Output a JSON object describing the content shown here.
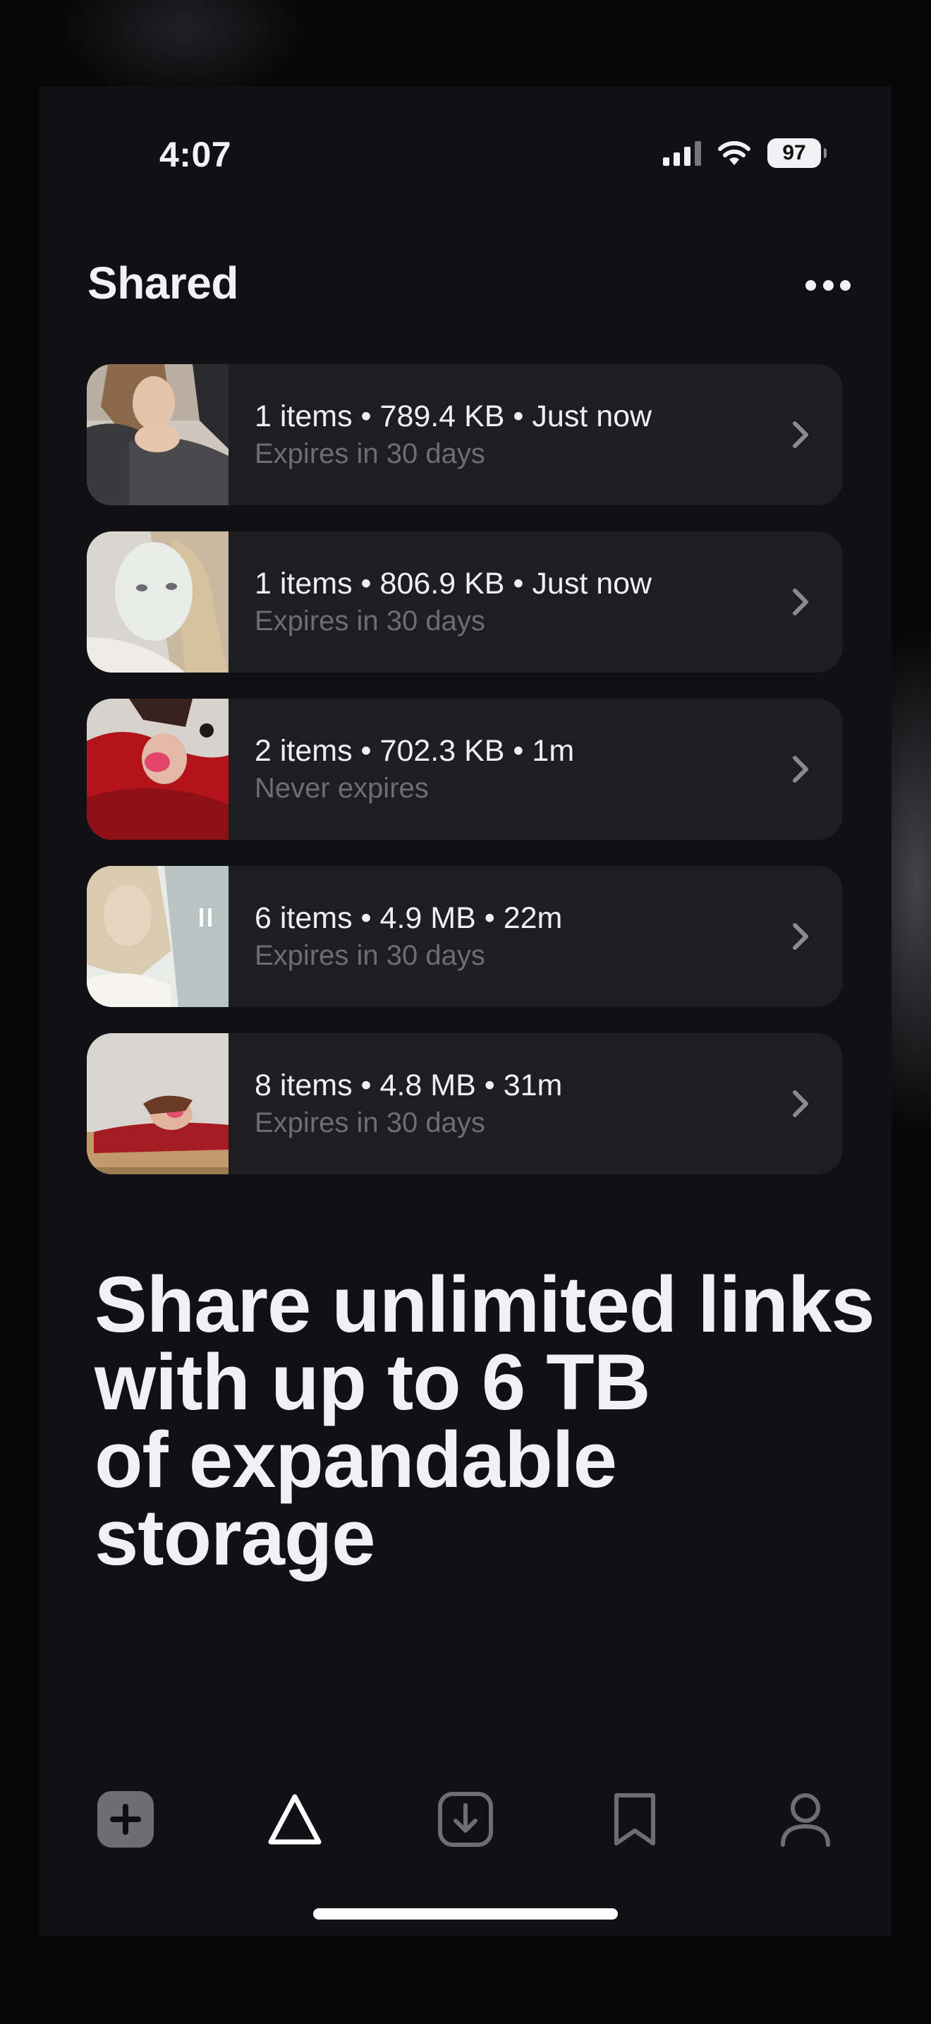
{
  "status_bar": {
    "time": "4:07",
    "battery": "97"
  },
  "header": {
    "title": "Shared",
    "more_icon": "ellipsis-icon"
  },
  "shared_items": [
    {
      "meta": "1 items • 789.4 KB • Just now",
      "expiry": "Expires in 30 days"
    },
    {
      "meta": "1 items • 806.9 KB • Just now",
      "expiry": "Expires in 30 days"
    },
    {
      "meta": "2 items • 702.3 KB • 1m",
      "expiry": "Never expires"
    },
    {
      "meta": "6 items • 4.9 MB • 22m",
      "expiry": "Expires in 30 days"
    },
    {
      "meta": "8 items • 4.8 MB • 31m",
      "expiry": "Expires in 30 days"
    }
  ],
  "promo": {
    "lines": [
      "Share unlimited links",
      "with up to 6 TB",
      "of expandable",
      "storage"
    ]
  },
  "tabbar": {
    "tabs": [
      "plus-icon",
      "send-icon",
      "download-icon",
      "bookmark-icon",
      "profile-icon"
    ],
    "active": "send-icon"
  },
  "colors": {
    "background": "#111115",
    "card": "#1e1e21",
    "secondary_text": "#6d6d72",
    "primary_text": "#f2f2f4"
  }
}
